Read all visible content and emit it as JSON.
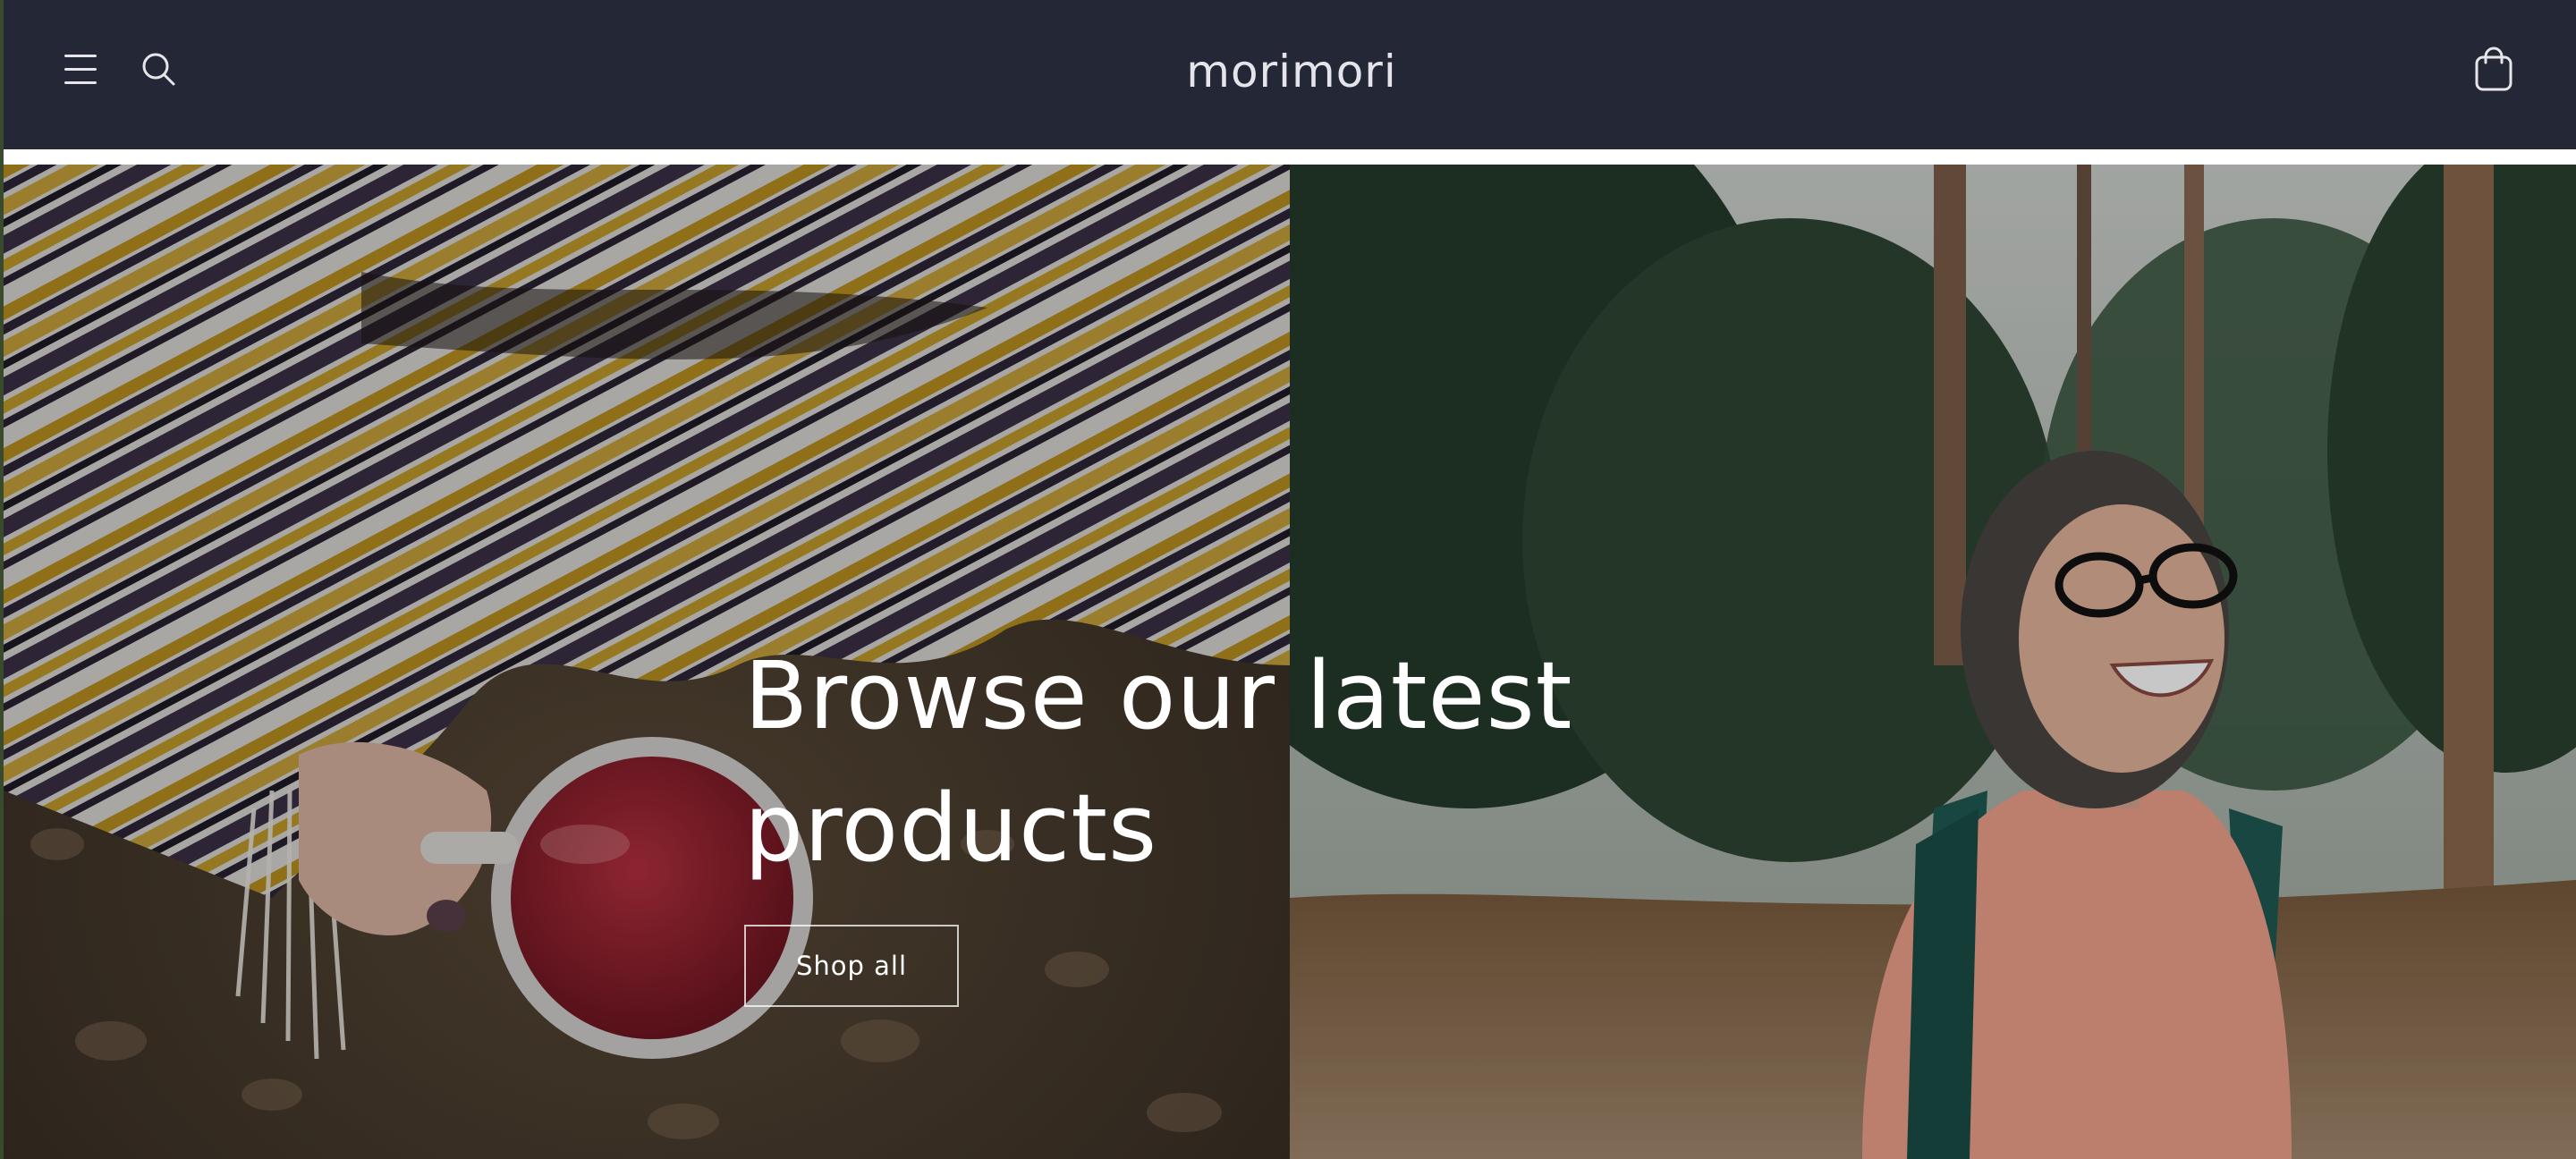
{
  "header": {
    "logo_text": "morimori",
    "menu_icon": "hamburger-menu-icon",
    "search_icon": "search-icon",
    "cart_icon": "shopping-bag-icon"
  },
  "hero": {
    "heading_line1": "Browse our latest",
    "heading_line2": "products",
    "button_label": "Shop all",
    "left_image": "person-in-striped-blanket-holding-mug-of-tea",
    "right_image": "smiling-woman-with-glasses-and-backpack-in-forest"
  },
  "colors": {
    "header_bg": "#242735",
    "header_text": "#e4e4ea",
    "hero_text": "#ffffff"
  }
}
